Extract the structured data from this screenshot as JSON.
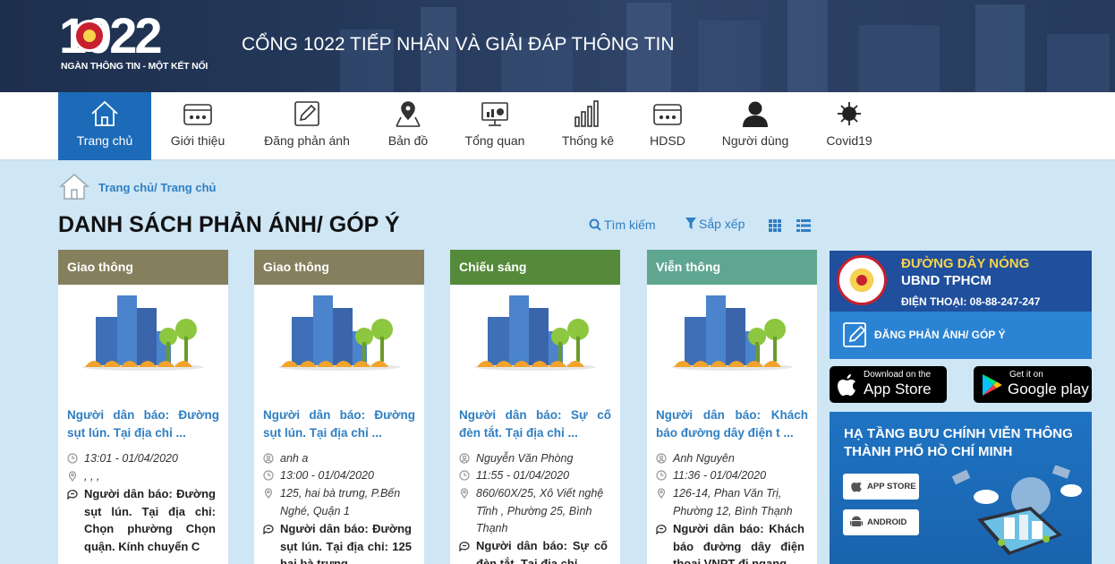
{
  "header": {
    "logo_number": "1022",
    "logo_tagline": "NGÀN THÔNG TIN - MỘT KẾT NỐI",
    "site_title": "CỔNG 1022 TIẾP NHẬN VÀ GIẢI ĐÁP THÔNG TIN"
  },
  "nav": {
    "items": [
      {
        "label": "Trang chủ",
        "icon": "home-icon",
        "active": true
      },
      {
        "label": "Giới thiệu",
        "icon": "info-box-icon"
      },
      {
        "label": "Đăng phản ánh",
        "icon": "edit-icon"
      },
      {
        "label": "Bản đồ",
        "icon": "map-pin-icon"
      },
      {
        "label": "Tổng quan",
        "icon": "monitor-chart-icon"
      },
      {
        "label": "Thống kê",
        "icon": "bar-chart-icon"
      },
      {
        "label": "HDSD",
        "icon": "manual-icon"
      },
      {
        "label": "Người dùng",
        "icon": "user-icon"
      },
      {
        "label": "Covid19",
        "icon": "virus-icon"
      }
    ]
  },
  "breadcrumb": {
    "text": "Trang chủ/ Trang chủ"
  },
  "page_title": "DANH SÁCH PHẢN ÁNH/ GÓP Ý",
  "tools": {
    "search": "Tìm kiếm",
    "sort": "Sắp xếp"
  },
  "colors": {
    "brand_blue": "#1d6bb8",
    "link_blue": "#2f7fc2",
    "hotline_yellow": "#f6d34b"
  },
  "cards": [
    {
      "category": "Giao thông",
      "color": "#857f5e",
      "title": "Người dân báo: Đường sụt lún. Tại địa chỉ ...",
      "author": "",
      "time": "13:01 - 01/04/2020",
      "address": ", , ,",
      "description": "Người dân báo: Đường sụt lún. Tại địa chỉ: Chọn phường Chọn quận. Kính chuyển C"
    },
    {
      "category": "Giao thông",
      "color": "#857f5e",
      "title": "Người dân báo: Đường sụt lún. Tại địa chỉ ...",
      "author": "anh a",
      "time": "13:00 - 01/04/2020",
      "address": "125, hai bà trưng, P.Bến Nghé, Quận 1",
      "description": "Người dân báo: Đường sụt lún. Tại địa chỉ: 125 hai bà trưng"
    },
    {
      "category": "Chiếu sáng",
      "color": "#548a3a",
      "title": "Người dân báo: Sự cố đèn tắt. Tại địa chỉ ...",
      "author": "Nguyễn Văn Phòng",
      "time": "11:55 - 01/04/2020",
      "address": "860/60X/25, Xô Viết nghệ Tĩnh , Phường 25, Bình Thạnh",
      "description": "Người dân báo: Sự cố đèn tắt. Tại địa chỉ"
    },
    {
      "category": "Viễn thông",
      "color": "#5fa691",
      "title": "Người dân báo: Khách báo đường dây điện t ...",
      "author": "Anh Nguyên",
      "time": "11:36 - 01/04/2020",
      "address": "126-14, Phan Văn Trị, Phường 12, Bình Thạnh",
      "description": "Người dân báo: Khách báo đường dây điện thoại VNPT đi ngang"
    }
  ],
  "sidebar": {
    "hotline": {
      "line1": "ĐƯỜNG DÂY NÓNG",
      "line2": "UBND TPHCM",
      "phone": "ĐIỆN THOẠI: 08-88-247-247"
    },
    "report_button": "ĐĂNG PHẢN ÁNH/ GÓP Ý",
    "app_store": {
      "small": "Download on the",
      "big": "App Store"
    },
    "google_play": {
      "small": "Get it on",
      "big": "Google play"
    },
    "infra": {
      "title1": "HẠ TẦNG BƯU CHÍNH VIỄN THÔNG",
      "title2": "THÀNH PHỐ HỒ CHÍ MINH",
      "app_store_pill": "APP STORE",
      "android_pill": "ANDROID"
    }
  }
}
